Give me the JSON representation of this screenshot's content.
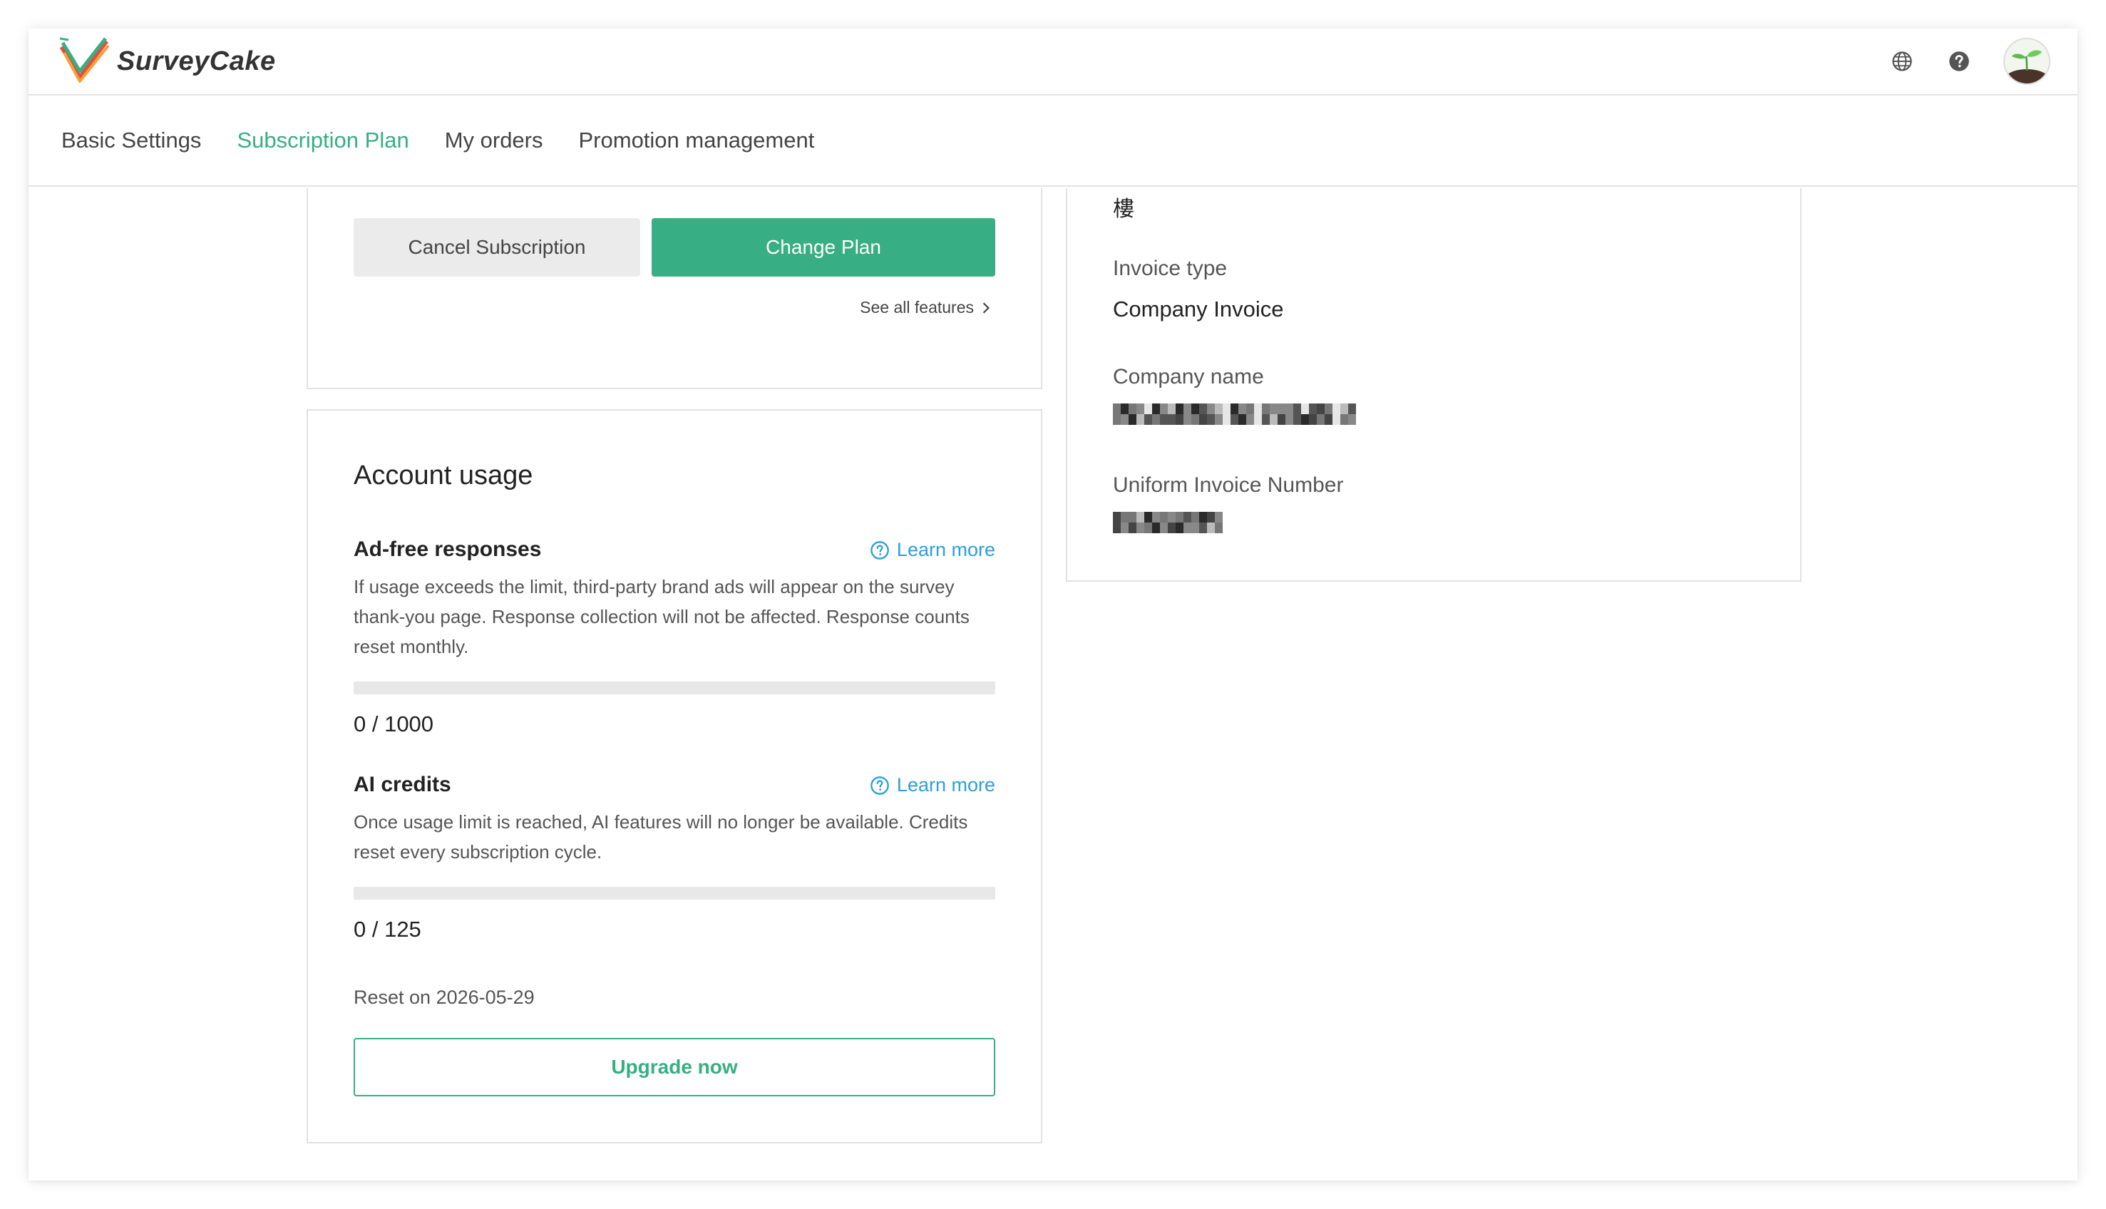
{
  "app": {
    "brand": "SurveyCake",
    "brand_color": "#37ae83",
    "link_color": "#2c9fd8"
  },
  "header": {
    "icons": [
      "globe-icon",
      "help-icon"
    ],
    "avatar": "sprout-avatar"
  },
  "tabs": [
    {
      "label": "Basic Settings",
      "active": false
    },
    {
      "label": "Subscription Plan",
      "active": true
    },
    {
      "label": "My orders",
      "active": false
    },
    {
      "label": "Promotion management",
      "active": false
    }
  ],
  "plan_card": {
    "cancel_label": "Cancel Subscription",
    "change_label": "Change Plan",
    "see_all_label": "See all features"
  },
  "usage": {
    "title": "Account usage",
    "ad_free": {
      "title": "Ad-free responses",
      "learn_more": "Learn more",
      "description": "If usage exceeds the limit, third-party brand ads will appear on the survey thank-you page. Response collection will not be affected. Response counts reset monthly.",
      "used": 0,
      "limit": 1000,
      "count_text": "0 / 1000"
    },
    "ai_credits": {
      "title": "AI credits",
      "learn_more": "Learn more",
      "description": "Once usage limit is reached, AI features will no longer be available. Credits reset every subscription cycle.",
      "used": 0,
      "limit": 125,
      "count_text": "0 / 125"
    },
    "reset_text": "Reset on 2026-05-29",
    "upgrade_label": "Upgrade now"
  },
  "invoice": {
    "address_tail": "樓",
    "invoice_type_label": "Invoice type",
    "invoice_type_value": "Company Invoice",
    "company_name_label": "Company name",
    "uniform_number_label": "Uniform Invoice Number"
  }
}
